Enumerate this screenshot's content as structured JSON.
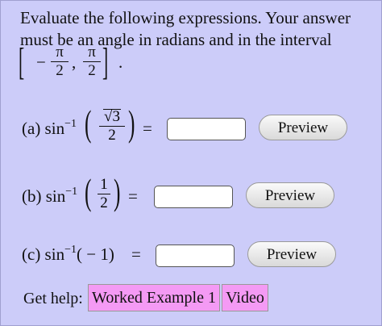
{
  "intro": "Evaluate the following expressions. Your answer must be an angle in radians and in the interval",
  "interval": {
    "open_bracket": "[",
    "close_bracket": "]",
    "left_minus": "−",
    "pi": "π",
    "den": "2",
    "comma": ",",
    "period": "."
  },
  "parts": [
    {
      "label": "(a) sin",
      "superscript": "−1",
      "numerator_root": "√3",
      "denominator": "2",
      "equals": "=",
      "preview_label": "Preview"
    },
    {
      "label": "(b) sin",
      "superscript": "−1",
      "numerator": "1",
      "denominator": "2",
      "equals": "=",
      "preview_label": "Preview"
    },
    {
      "label": "(c) sin",
      "superscript": "−1",
      "argument": "( − 1)",
      "equals": "=",
      "preview_label": "Preview"
    }
  ],
  "help": {
    "label": "Get help:",
    "worked_example": "Worked Example 1",
    "video": "Video"
  },
  "colors": {
    "panel_bg": "#ccccf9",
    "help_button_bg": "#f49af4"
  }
}
